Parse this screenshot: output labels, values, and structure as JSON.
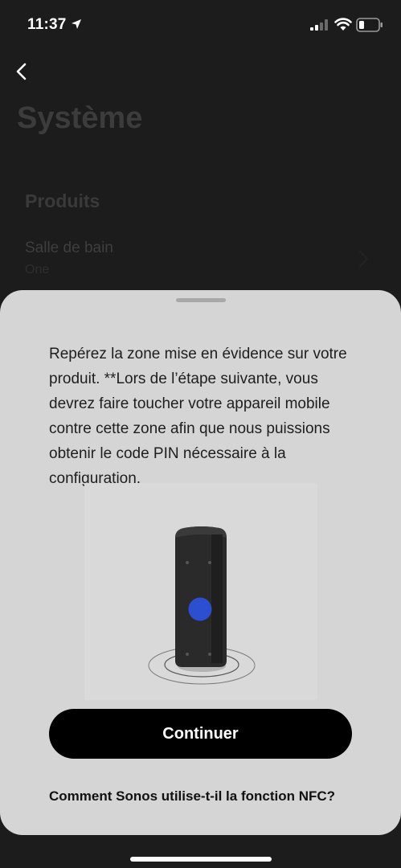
{
  "status_bar": {
    "time": "11:37",
    "icons": [
      "location-arrow-icon",
      "cellular-signal-icon",
      "wifi-icon",
      "battery-icon"
    ]
  },
  "header": {
    "back_icon": "chevron-left-icon",
    "title": "Système"
  },
  "products": {
    "section_title": "Produits",
    "items": [
      {
        "name": "Salle de bain",
        "model": "One",
        "icon": "chevron-right-icon"
      }
    ]
  },
  "sheet": {
    "instructions": "Repérez la zone mise en évidence sur votre produit. **Lors de l’étape suivante, vous devrez faire toucher votre appareil mobile contre cette zone afin que nous puissions obtenir le code PIN nécessaire à la configuration.",
    "illustration": "speaker-nfc-zone-illustration",
    "continue_label": "Continuer",
    "nfc_link": "Comment Sonos utilise-t-il la fonction NFC?"
  },
  "colors": {
    "accent_zone": "#2c4fd1",
    "button_bg": "#000000",
    "sheet_bg": "#d5d5d5"
  }
}
